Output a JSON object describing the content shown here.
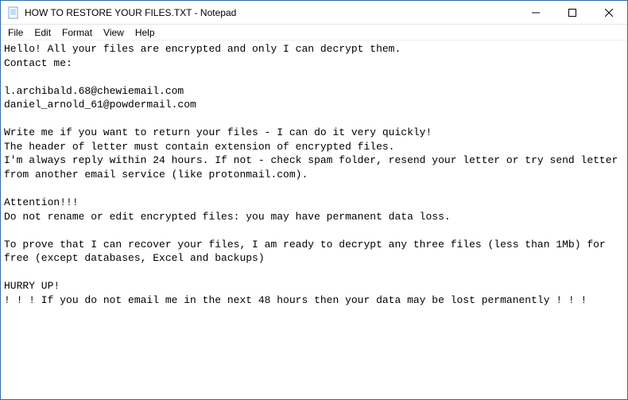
{
  "window": {
    "title": "HOW TO RESTORE YOUR FILES.TXT - Notepad"
  },
  "menu": {
    "file": "File",
    "edit": "Edit",
    "format": "Format",
    "view": "View",
    "help": "Help"
  },
  "body": {
    "text": "Hello! All your files are encrypted and only I can decrypt them.\nContact me:\n\nl.archibald.68@chewiemail.com\ndaniel_arnold_61@powdermail.com\n\nWrite me if you want to return your files - I can do it very quickly!\nThe header of letter must contain extension of encrypted files.\nI'm always reply within 24 hours. If not - check spam folder, resend your letter or try send letter from another email service (like protonmail.com).\n\nAttention!!!\nDo not rename or edit encrypted files: you may have permanent data loss.\n\nTo prove that I can recover your files, I am ready to decrypt any three files (less than 1Mb) for free (except databases, Excel and backups)\n\nHURRY UP!\n! ! ! If you do not email me in the next 48 hours then your data may be lost permanently ! ! !"
  }
}
